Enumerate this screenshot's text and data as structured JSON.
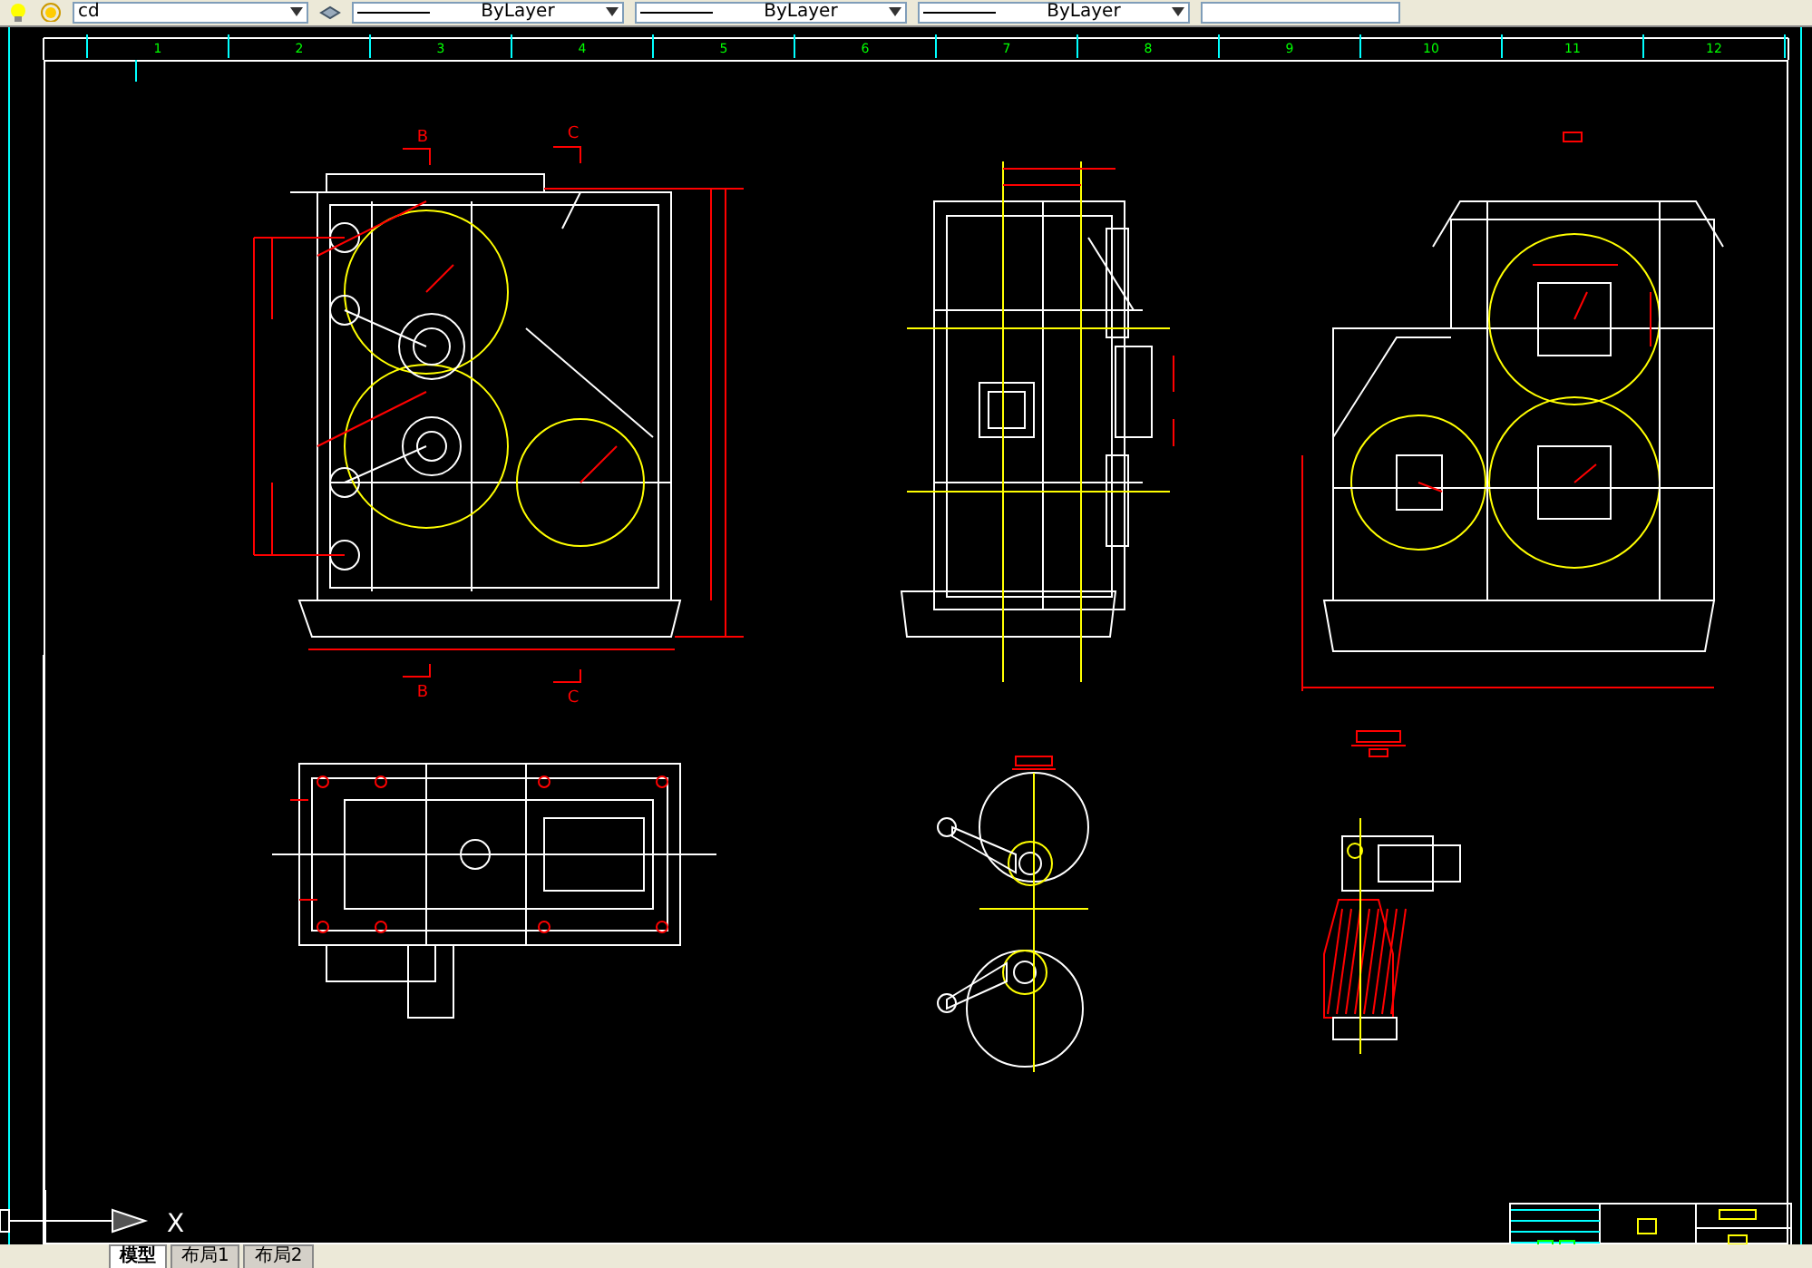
{
  "toolbar": {
    "layer_value": "cd",
    "linetype_fields": [
      "ByLayer",
      "ByLayer",
      "ByLayer"
    ]
  },
  "ruler": {
    "numbers": [
      "1",
      "2",
      "3",
      "4",
      "5",
      "6",
      "7",
      "8",
      "9",
      "10",
      "11",
      "12"
    ]
  },
  "section_labels": [
    "B",
    "C",
    "B",
    "C"
  ],
  "ucs": {
    "axis_label": "X"
  },
  "tabs": [
    {
      "label": "模型",
      "selected": true
    },
    {
      "label": "布局1",
      "selected": false
    },
    {
      "label": "布局2",
      "selected": false
    }
  ]
}
